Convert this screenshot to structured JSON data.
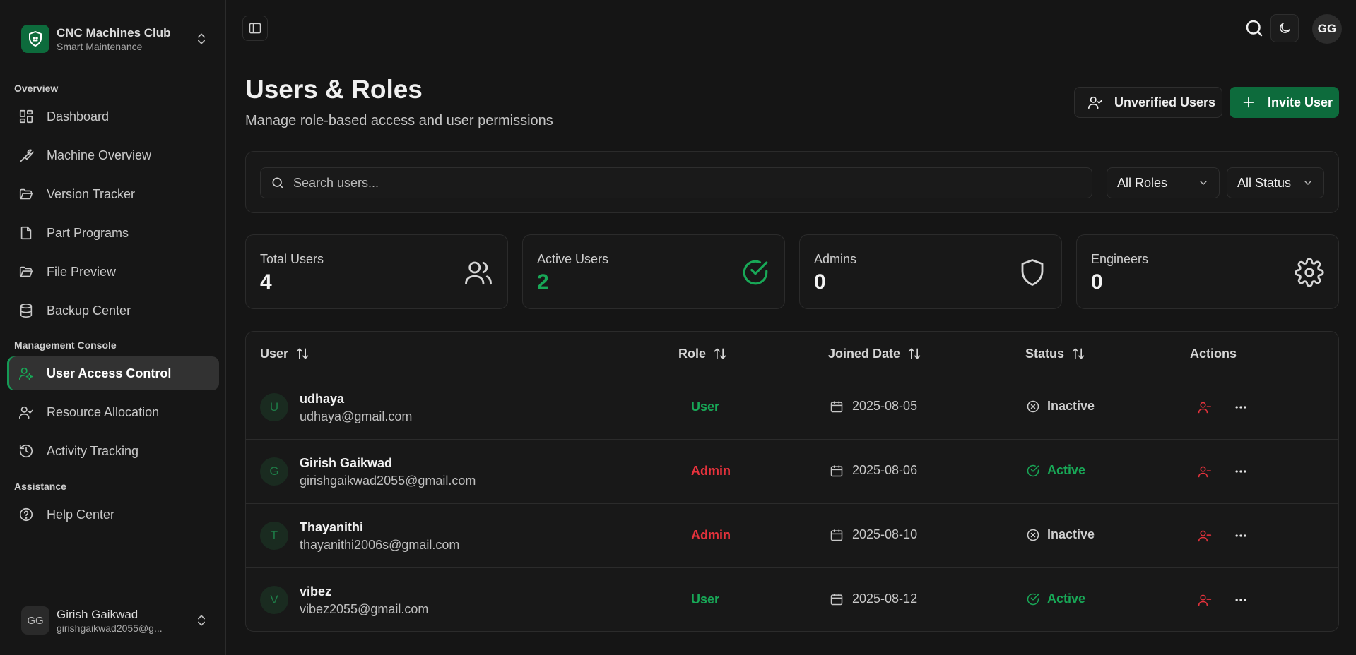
{
  "brand": {
    "title": "CNC Machines Club",
    "subtitle": "Smart Maintenance"
  },
  "colors": {
    "accent": "#0d6b3c",
    "success": "#18a857",
    "danger": "#e5323c"
  },
  "sidebar": {
    "sections": [
      {
        "label": "Overview"
      },
      {
        "label": "Management Console"
      },
      {
        "label": "Assistance"
      }
    ],
    "items": [
      {
        "label": "Dashboard",
        "icon": "grid-icon"
      },
      {
        "label": "Machine Overview",
        "icon": "wrench-icon"
      },
      {
        "label": "Version Tracker",
        "icon": "folder-open-icon"
      },
      {
        "label": "Part Programs",
        "icon": "file-icon"
      },
      {
        "label": "File Preview",
        "icon": "folder-open-icon"
      },
      {
        "label": "Backup Center",
        "icon": "database-icon"
      },
      {
        "label": "User Access Control",
        "icon": "user-cog-icon",
        "active": true
      },
      {
        "label": "Resource Allocation",
        "icon": "user-check-icon"
      },
      {
        "label": "Activity Tracking",
        "icon": "history-icon"
      },
      {
        "label": "Help Center",
        "icon": "help-circle-icon"
      }
    ],
    "user": {
      "initials": "GG",
      "name": "Girish Gaikwad",
      "email": "girishgaikwad2055@g..."
    }
  },
  "topbar": {
    "avatar_initials": "GG"
  },
  "page": {
    "title": "Users & Roles",
    "subtitle": "Manage role-based access and user permissions",
    "unverified_label": "Unverified Users",
    "invite_label": "Invite User"
  },
  "filters": {
    "search_placeholder": "Search users...",
    "role_selected": "All Roles",
    "status_selected": "All Status"
  },
  "stats": [
    {
      "label": "Total Users",
      "value": "4",
      "icon": "users-icon"
    },
    {
      "label": "Active Users",
      "value": "2",
      "icon": "check-circle-icon"
    },
    {
      "label": "Admins",
      "value": "0",
      "icon": "shield-icon"
    },
    {
      "label": "Engineers",
      "value": "0",
      "icon": "gear-icon"
    }
  ],
  "table": {
    "columns": [
      "User",
      "Role",
      "Joined Date",
      "Status",
      "Actions"
    ],
    "rows": [
      {
        "initial": "U",
        "name": "udhaya",
        "email": "udhaya@gmail.com",
        "role": "User",
        "joined": "2025-08-05",
        "status": "Inactive"
      },
      {
        "initial": "G",
        "name": "Girish Gaikwad",
        "email": "girishgaikwad2055@gmail.com",
        "role": "Admin",
        "joined": "2025-08-06",
        "status": "Active"
      },
      {
        "initial": "T",
        "name": "Thayanithi",
        "email": "thayanithi2006s@gmail.com",
        "role": "Admin",
        "joined": "2025-08-10",
        "status": "Inactive"
      },
      {
        "initial": "V",
        "name": "vibez",
        "email": "vibez2055@gmail.com",
        "role": "User",
        "joined": "2025-08-12",
        "status": "Active"
      }
    ]
  }
}
